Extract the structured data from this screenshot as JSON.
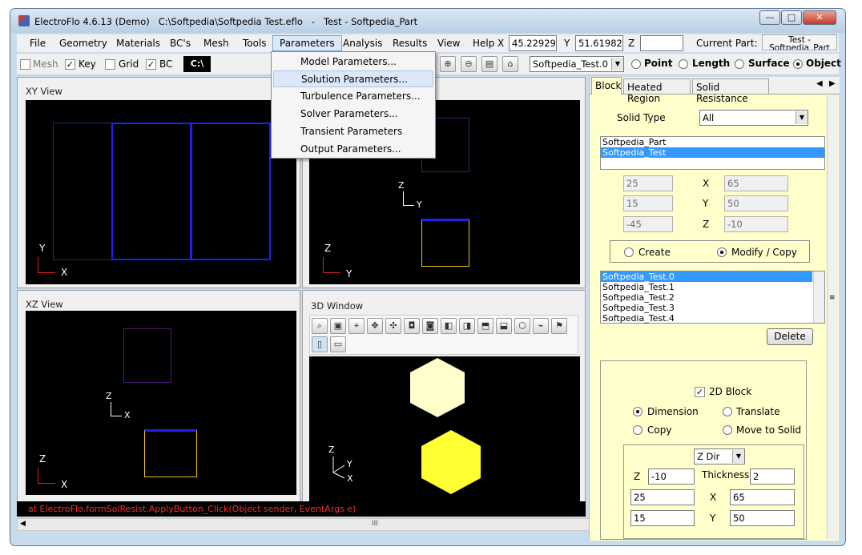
{
  "window": {
    "title": "ElectroFlo 4.6.13 (Demo)   C:\\Softpedia\\Softpedia Test.eflo   -   Test - Softpedia_Part",
    "min": "—",
    "max": "□",
    "close": "✕"
  },
  "menu": [
    "File",
    "Geometry",
    "Materials",
    "BC's",
    "Mesh",
    "Tools",
    "Parameters",
    "Analysis",
    "Results",
    "View",
    "Help"
  ],
  "coords": {
    "x_label": "X",
    "x_value": "45.22929",
    "y_label": "Y",
    "y_value": "51.61982",
    "z_label": "Z",
    "z_value": "",
    "current_part_label": "Current Part:",
    "current_part_value": "Test - Softpedia_Part"
  },
  "toolbar": {
    "mesh": "Mesh",
    "key": "Key",
    "grid": "Grid",
    "bc": "BC",
    "cmd": "C:\\",
    "object_select": "Softpedia_Test.0",
    "point": "Point",
    "length": "Length",
    "surface": "Surface",
    "object": "Object"
  },
  "parameters_menu": [
    "Model Parameters...",
    "Solution Parameters...",
    "Turbulence Parameters...",
    "Solver Parameters...",
    "Transient Parameters",
    "Output Parameters..."
  ],
  "views": {
    "xy": "XY View",
    "xz": "XZ View",
    "win3d": "3D Window",
    "axis_x": "X",
    "axis_y": "Y",
    "axis_z": "Z"
  },
  "status": {
    "error": "at ElectroFlo.formSolResist.ApplyButton_Click(Object sender, EventArgs e)",
    "grip": "III"
  },
  "panel": {
    "tabs": [
      "Block",
      "Heated Region",
      "Solid Resistance"
    ],
    "solid_type_label": "Solid Type",
    "solid_type_value": "All",
    "parts": [
      "Softpedia_Part",
      "Softpedia_Test"
    ],
    "x_label": "X",
    "y_label": "Y",
    "z_label": "Z",
    "x_min": "25",
    "x_max": "65",
    "y_min": "15",
    "y_max": "50",
    "z_min": "-45",
    "z_max": "-10",
    "create": "Create",
    "modify": "Modify / Copy",
    "objects": [
      "Softpedia_Test.0",
      "Softpedia_Test.1",
      "Softpedia_Test.2",
      "Softpedia_Test.3",
      "Softpedia_Test.4"
    ],
    "delete": "Delete",
    "block2d": "2D Block",
    "dimension": "Dimension",
    "translate": "Translate",
    "copy": "Copy",
    "move": "Move to Solid",
    "dir_value": "Z Dir",
    "z_value": "-10",
    "thickness_label": "Thickness",
    "thickness_value": "2",
    "bx1": "25",
    "bx2": "65",
    "by1": "15",
    "by2": "50"
  },
  "colors": {
    "accent_purple": "#4a1a6e",
    "accent_blue": "#2020ee",
    "hex_light": "#ffffcc",
    "hex_bright": "#ffff33",
    "select": "#3399ff"
  }
}
